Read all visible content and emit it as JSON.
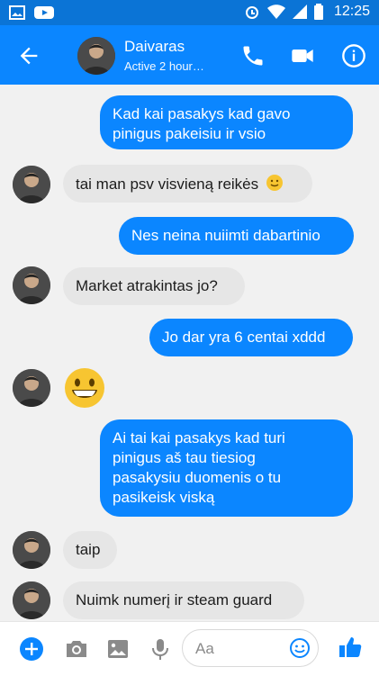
{
  "status": {
    "time": "12:25",
    "icons": [
      "image-icon",
      "youtube-icon",
      "alarm-icon",
      "wifi-icon",
      "signal-icon",
      "battery-icon"
    ]
  },
  "header": {
    "contact_name": "Daivaras",
    "status_text": "Active 2 hour…",
    "icons": [
      "back-arrow-icon",
      "phone-icon",
      "video-icon",
      "info-icon"
    ],
    "accent": "#0b86ff"
  },
  "messages": [
    {
      "from": "me",
      "text_lines": [
        "Kad kai pasakys kad gavo",
        "pinigus pakeisiu ir vsio"
      ]
    },
    {
      "from": "them",
      "text": "tai man psv visvieną reikės",
      "emoji": "slight-smile-icon"
    },
    {
      "from": "me",
      "text": "Nes neina nuiimti dabartinio"
    },
    {
      "from": "them",
      "text": "Market atrakintas jo?"
    },
    {
      "from": "me",
      "text": "Jo dar yra 6 centai xddd"
    },
    {
      "from": "them",
      "emoji_only": "grin-emoji-icon"
    },
    {
      "from": "me",
      "text_lines": [
        "Ai tai kai pasakys kad turi",
        "pinigus aš tau tiesiog",
        "pasakysiu duomenis o tu",
        "pasikeisk viską"
      ]
    },
    {
      "from": "them",
      "text": "taip"
    },
    {
      "from": "them",
      "text": "Nuimk numerį ir steam guard"
    }
  ],
  "composer": {
    "placeholder": "Aa",
    "icons": [
      "plus-icon",
      "camera-icon",
      "gallery-icon",
      "microphone-icon",
      "emoji-icon",
      "like-thumb-icon"
    ]
  }
}
